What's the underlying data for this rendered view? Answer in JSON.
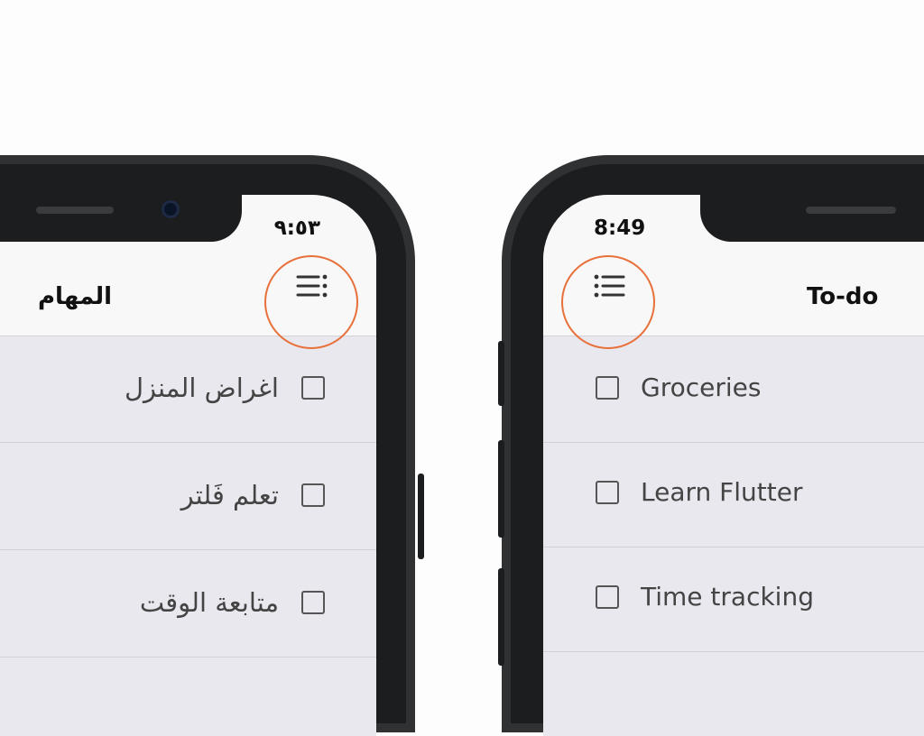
{
  "colors": {
    "highlight_ring": "#e8703a",
    "frame": "#1c1d1f",
    "screen_background": "#e9e8ee",
    "bar_background": "#f8f8f8"
  },
  "arabic_phone": {
    "status_time": "٩:٥٣",
    "title": "المهام",
    "menu_icon": "list-rtl-icon",
    "tasks": [
      {
        "label": "اغراض المنزل",
        "checked": false
      },
      {
        "label": "تعلم فَلتر",
        "checked": false
      },
      {
        "label": "متابعة الوقت",
        "checked": false
      }
    ]
  },
  "english_phone": {
    "status_time": "8:49",
    "title": "To-do",
    "menu_icon": "list-icon",
    "tasks": [
      {
        "label": "Groceries",
        "checked": false
      },
      {
        "label": "Learn Flutter",
        "checked": false
      },
      {
        "label": "Time tracking",
        "checked": false
      }
    ]
  }
}
